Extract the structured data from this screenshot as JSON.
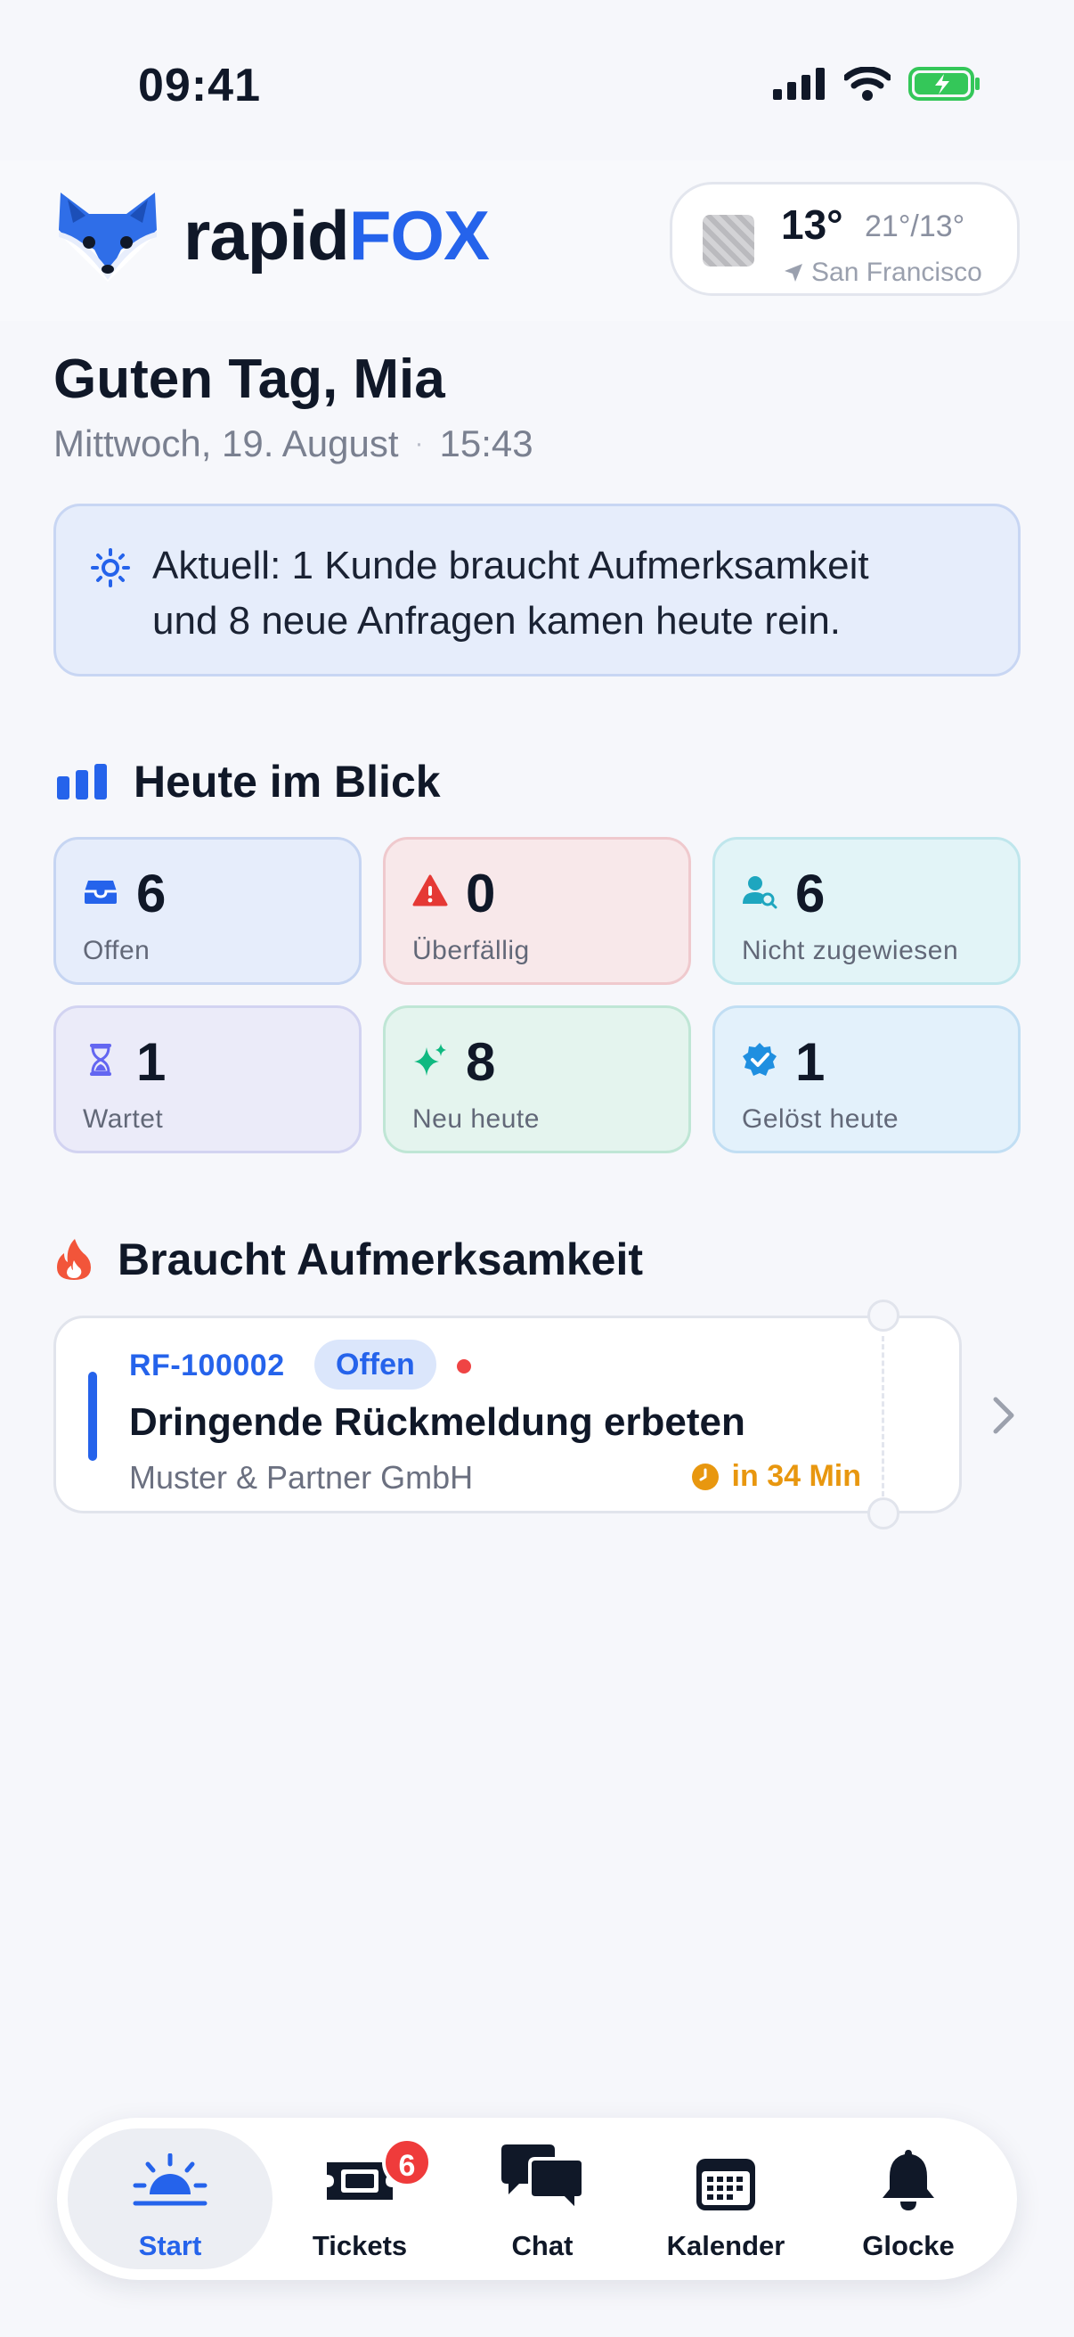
{
  "status_bar": {
    "time": "09:41"
  },
  "header": {
    "logo_part1": "rapid",
    "logo_part2": "FOX",
    "weather": {
      "temp": "13°",
      "range": "21°/13°",
      "city": "San Francisco"
    }
  },
  "greeting": {
    "title": "Guten Tag, Mia",
    "date": "Mittwoch, 19. August",
    "separator": "·",
    "time": "15:43"
  },
  "notice": {
    "icon": "sun-icon",
    "line1": "Aktuell: 1 Kunde braucht Aufmerksamkeit",
    "line2": "und 8 neue Anfragen kamen heute rein."
  },
  "overview": {
    "title": "Heute im Blick",
    "tiles": [
      {
        "value": "6",
        "label": "Offen",
        "icon": "inbox-icon",
        "bg": "#e6edfb",
        "border": "#c6d5f2",
        "color": "#2563eb"
      },
      {
        "value": "0",
        "label": "Überfällig",
        "icon": "warning-icon",
        "bg": "#f8e8ea",
        "border": "#efc9cd",
        "color": "#e53935"
      },
      {
        "value": "6",
        "label": "Nicht zugewiesen",
        "icon": "user-search-icon",
        "bg": "#e2f4f7",
        "border": "#bfe6ec",
        "color": "#1ea6bf"
      },
      {
        "value": "1",
        "label": "Wartet",
        "icon": "hourglass-icon",
        "bg": "#ebebf9",
        "border": "#d2d3f1",
        "color": "#6366f1"
      },
      {
        "value": "8",
        "label": "Neu heute",
        "icon": "sparkles-icon",
        "bg": "#e4f4ee",
        "border": "#bfe6d5",
        "color": "#10b981"
      },
      {
        "value": "1",
        "label": "Gelöst heute",
        "icon": "verified-icon",
        "bg": "#e3f1fb",
        "border": "#c1def3",
        "color": "#1f8fe0"
      }
    ]
  },
  "attention": {
    "title": "Braucht Aufmerksamkeit",
    "ticket": {
      "id": "RF-100002",
      "status": "Offen",
      "title": "Dringende Rückmeldung erbeten",
      "company": "Muster & Partner GmbH",
      "due": "in 34 Min"
    }
  },
  "tabbar": {
    "tabs": [
      {
        "label": "Start",
        "icon": "sunrise-icon",
        "active": true
      },
      {
        "label": "Tickets",
        "icon": "ticket-icon",
        "badge": "6"
      },
      {
        "label": "Chat",
        "icon": "chat-bubbles-icon"
      },
      {
        "label": "Kalender",
        "icon": "calendar-icon"
      },
      {
        "label": "Glocke",
        "icon": "bell-icon"
      }
    ]
  }
}
